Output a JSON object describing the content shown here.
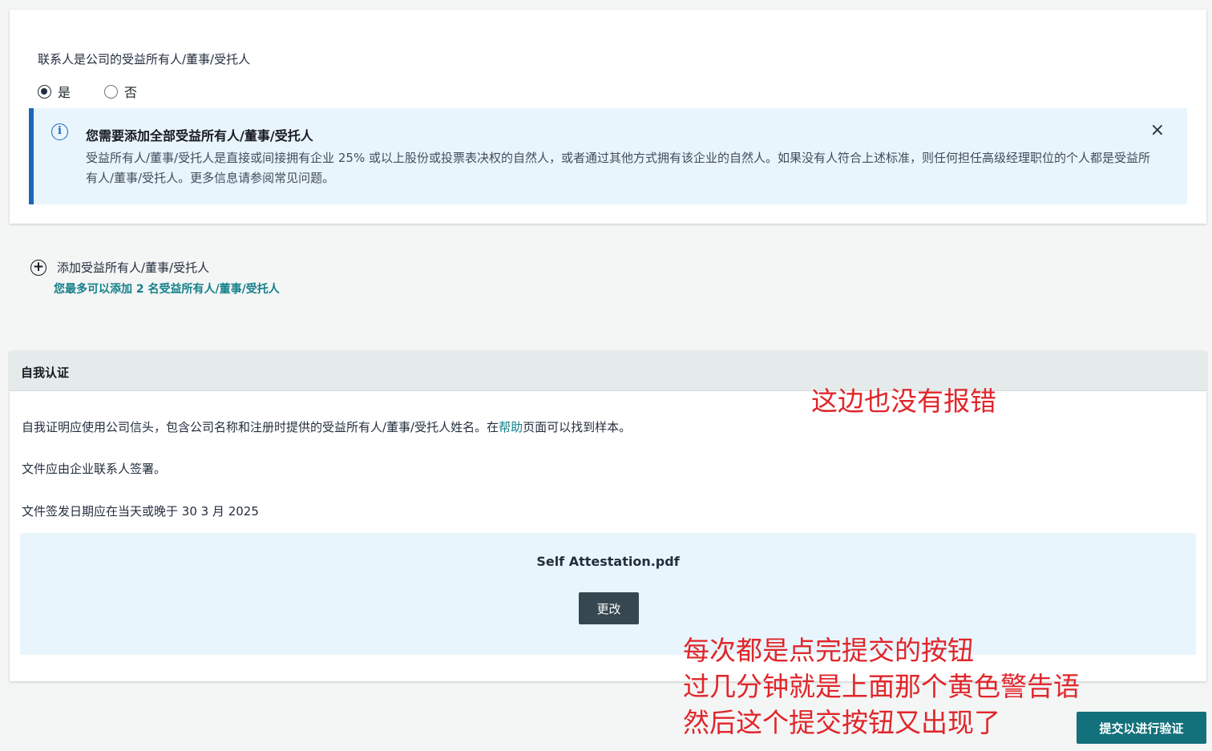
{
  "owner_question": {
    "label": "联系人是公司的受益所有人/董事/受托人",
    "options": [
      {
        "label": "是",
        "selected": true
      },
      {
        "label": "否",
        "selected": false
      }
    ]
  },
  "info_alert": {
    "title": "您需要添加全部受益所有人/董事/受托人",
    "body": "受益所有人/董事/受托人是直接或间接拥有企业 25% 或以上股份或投票表决权的自然人，或者通过其他方式拥有该企业的自然人。如果没有人符合上述标准，则任何担任高级经理职位的个人都是受益所有人/董事/受托人。更多信息请参阅常见问题。",
    "icon": "info-icon",
    "close_icon": "×"
  },
  "add_owner": {
    "label": "添加受益所有人/董事/受托人",
    "hint": "您最多可以添加 2 名受益所有人/董事/受托人"
  },
  "self_attestation": {
    "title": "自我认证",
    "para1_prefix": "自我证明应使用公司信头，包含公司名称和注册时提供的受益所有人/董事/受托人姓名。在",
    "para1_link": "帮助",
    "para1_suffix": "页面可以找到样本。",
    "para2": "文件应由企业联系人签署。",
    "para3": "文件签发日期应在当天或晚于 30 3 月 2025",
    "file_name": "Self Attestation.pdf",
    "change_label": "更改"
  },
  "annotations": {
    "note1": "这边也没有报错",
    "note2_line1": "每次都是点完提交的按钮",
    "note2_line2": "过几分钟就是上面那个黄色警告语",
    "note2_line3": "然后这个提交按钮又出现了"
  },
  "submit_label": "提交以进行验证",
  "colors": {
    "accent": "#14808a",
    "info_border": "#1a67b8",
    "info_bg": "#e9f5fc",
    "annotation": "#e0262b",
    "submit_bg": "#12717b"
  }
}
